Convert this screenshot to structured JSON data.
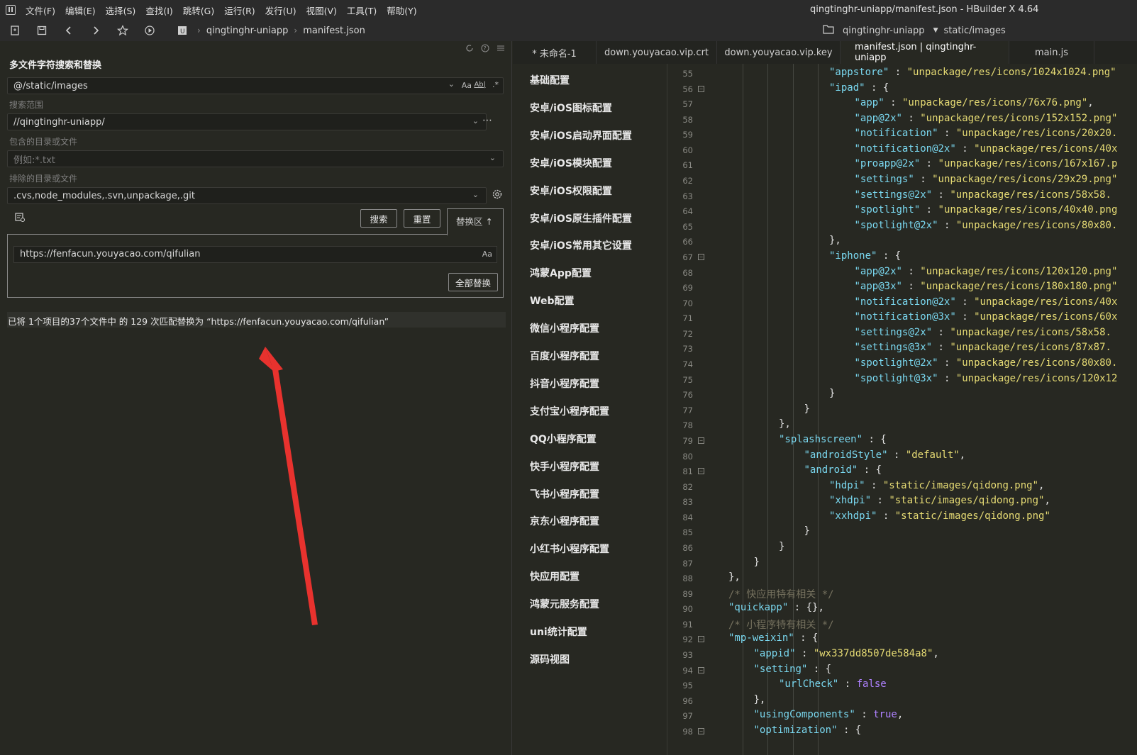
{
  "menubar": {
    "items": [
      "文件(F)",
      "编辑(E)",
      "选择(S)",
      "查找(I)",
      "跳转(G)",
      "运行(R)",
      "发行(U)",
      "视图(V)",
      "工具(T)",
      "帮助(Y)"
    ],
    "window_title": "qingtinghr-uniapp/manifest.json - HBuilder X 4.64"
  },
  "toolbar": {
    "crumb_project": "qingtinghr-uniapp",
    "crumb_file": "manifest.json",
    "right_project": "qingtinghr-uniapp",
    "right_path": "static/images"
  },
  "search_panel": {
    "title": "多文件字符搜索和替换",
    "search_value": "@/static/images",
    "option_case": "Aa",
    "option_word": "Ab|",
    "option_regex": ".*",
    "scope_label": "搜索范围",
    "scope_value": "//qingtinghr-uniapp/",
    "include_label": "包含的目录或文件",
    "include_placeholder": "例如:*.txt",
    "exclude_label": "排除的目录或文件",
    "exclude_value": ".cvs,node_modules,.svn,unpackage,.git",
    "search_button": "搜索",
    "reset_button": "重置",
    "replace_tab": "替换区 ↑",
    "replace_value": "https://fenfacun.youyacao.com/qifulian",
    "replace_case": "Aa",
    "replace_all_button": "全部替换",
    "status": "已将 1个项目的37个文件中 的 129 次匹配替换为 “https://fenfacun.youyacao.com/qifulian”"
  },
  "tabs": [
    {
      "label": "* 未命名-1",
      "active": false
    },
    {
      "label": "down.youyacao.vip.crt",
      "active": false
    },
    {
      "label": "down.youyacao.vip.key",
      "active": false
    },
    {
      "label": "manifest.json | qingtinghr-uniapp",
      "active": true
    },
    {
      "label": "main.js",
      "active": false
    }
  ],
  "manifest_nav": [
    "基础配置",
    "安卓/iOS图标配置",
    "安卓/iOS启动界面配置",
    "安卓/iOS模块配置",
    "安卓/iOS权限配置",
    "安卓/iOS原生插件配置",
    "安卓/iOS常用其它设置",
    "鸿蒙App配置",
    "Web配置",
    "微信小程序配置",
    "百度小程序配置",
    "抖音小程序配置",
    "支付宝小程序配置",
    "QQ小程序配置",
    "快手小程序配置",
    "飞书小程序配置",
    "京东小程序配置",
    "小红书小程序配置",
    "快应用配置",
    "鸿蒙元服务配置",
    "uni统计配置",
    "源码视图"
  ],
  "code_lines": [
    {
      "n": "55",
      "fold": false,
      "indent": 4,
      "parts": [
        [
          "k",
          "\"appstore\""
        ],
        [
          "p",
          " : "
        ],
        [
          "s",
          "\"unpackage/res/icons/1024x1024.png\""
        ]
      ]
    },
    {
      "n": "56",
      "fold": true,
      "indent": 4,
      "parts": [
        [
          "k",
          "\"ipad\""
        ],
        [
          "p",
          " : {"
        ]
      ]
    },
    {
      "n": "57",
      "fold": false,
      "indent": 5,
      "parts": [
        [
          "k",
          "\"app\""
        ],
        [
          "p",
          " : "
        ],
        [
          "s",
          "\"unpackage/res/icons/76x76.png\""
        ],
        [
          "p",
          ","
        ]
      ]
    },
    {
      "n": "58",
      "fold": false,
      "indent": 5,
      "parts": [
        [
          "k",
          "\"app@2x\""
        ],
        [
          "p",
          " : "
        ],
        [
          "s",
          "\"unpackage/res/icons/152x152.png\""
        ]
      ]
    },
    {
      "n": "59",
      "fold": false,
      "indent": 5,
      "parts": [
        [
          "k",
          "\"notification\""
        ],
        [
          "p",
          " : "
        ],
        [
          "s",
          "\"unpackage/res/icons/20x20."
        ]
      ]
    },
    {
      "n": "60",
      "fold": false,
      "indent": 5,
      "parts": [
        [
          "k",
          "\"notification@2x\""
        ],
        [
          "p",
          " : "
        ],
        [
          "s",
          "\"unpackage/res/icons/40x"
        ]
      ]
    },
    {
      "n": "61",
      "fold": false,
      "indent": 5,
      "parts": [
        [
          "k",
          "\"proapp@2x\""
        ],
        [
          "p",
          " : "
        ],
        [
          "s",
          "\"unpackage/res/icons/167x167.p"
        ]
      ]
    },
    {
      "n": "62",
      "fold": false,
      "indent": 5,
      "parts": [
        [
          "k",
          "\"settings\""
        ],
        [
          "p",
          " : "
        ],
        [
          "s",
          "\"unpackage/res/icons/29x29.png\""
        ]
      ]
    },
    {
      "n": "63",
      "fold": false,
      "indent": 5,
      "parts": [
        [
          "k",
          "\"settings@2x\""
        ],
        [
          "p",
          " : "
        ],
        [
          "s",
          "\"unpackage/res/icons/58x58."
        ]
      ]
    },
    {
      "n": "64",
      "fold": false,
      "indent": 5,
      "parts": [
        [
          "k",
          "\"spotlight\""
        ],
        [
          "p",
          " : "
        ],
        [
          "s",
          "\"unpackage/res/icons/40x40.png"
        ]
      ]
    },
    {
      "n": "65",
      "fold": false,
      "indent": 5,
      "parts": [
        [
          "k",
          "\"spotlight@2x\""
        ],
        [
          "p",
          " : "
        ],
        [
          "s",
          "\"unpackage/res/icons/80x80."
        ]
      ]
    },
    {
      "n": "66",
      "fold": false,
      "indent": 4,
      "parts": [
        [
          "p",
          "},"
        ]
      ]
    },
    {
      "n": "67",
      "fold": true,
      "indent": 4,
      "parts": [
        [
          "k",
          "\"iphone\""
        ],
        [
          "p",
          " : {"
        ]
      ]
    },
    {
      "n": "68",
      "fold": false,
      "indent": 5,
      "parts": [
        [
          "k",
          "\"app@2x\""
        ],
        [
          "p",
          " : "
        ],
        [
          "s",
          "\"unpackage/res/icons/120x120.png\""
        ]
      ]
    },
    {
      "n": "69",
      "fold": false,
      "indent": 5,
      "parts": [
        [
          "k",
          "\"app@3x\""
        ],
        [
          "p",
          " : "
        ],
        [
          "s",
          "\"unpackage/res/icons/180x180.png\""
        ]
      ]
    },
    {
      "n": "70",
      "fold": false,
      "indent": 5,
      "parts": [
        [
          "k",
          "\"notification@2x\""
        ],
        [
          "p",
          " : "
        ],
        [
          "s",
          "\"unpackage/res/icons/40x"
        ]
      ]
    },
    {
      "n": "71",
      "fold": false,
      "indent": 5,
      "parts": [
        [
          "k",
          "\"notification@3x\""
        ],
        [
          "p",
          " : "
        ],
        [
          "s",
          "\"unpackage/res/icons/60x"
        ]
      ]
    },
    {
      "n": "72",
      "fold": false,
      "indent": 5,
      "parts": [
        [
          "k",
          "\"settings@2x\""
        ],
        [
          "p",
          " : "
        ],
        [
          "s",
          "\"unpackage/res/icons/58x58."
        ]
      ]
    },
    {
      "n": "73",
      "fold": false,
      "indent": 5,
      "parts": [
        [
          "k",
          "\"settings@3x\""
        ],
        [
          "p",
          " : "
        ],
        [
          "s",
          "\"unpackage/res/icons/87x87."
        ]
      ]
    },
    {
      "n": "74",
      "fold": false,
      "indent": 5,
      "parts": [
        [
          "k",
          "\"spotlight@2x\""
        ],
        [
          "p",
          " : "
        ],
        [
          "s",
          "\"unpackage/res/icons/80x80."
        ]
      ]
    },
    {
      "n": "75",
      "fold": false,
      "indent": 5,
      "parts": [
        [
          "k",
          "\"spotlight@3x\""
        ],
        [
          "p",
          " : "
        ],
        [
          "s",
          "\"unpackage/res/icons/120x12"
        ]
      ]
    },
    {
      "n": "76",
      "fold": false,
      "indent": 4,
      "parts": [
        [
          "p",
          "}"
        ]
      ]
    },
    {
      "n": "77",
      "fold": false,
      "indent": 3,
      "parts": [
        [
          "p",
          "}"
        ]
      ]
    },
    {
      "n": "78",
      "fold": false,
      "indent": 2,
      "parts": [
        [
          "p",
          "},"
        ]
      ]
    },
    {
      "n": "79",
      "fold": true,
      "indent": 2,
      "parts": [
        [
          "k",
          "\"splashscreen\""
        ],
        [
          "p",
          " : {"
        ]
      ]
    },
    {
      "n": "80",
      "fold": false,
      "indent": 3,
      "parts": [
        [
          "k",
          "\"androidStyle\""
        ],
        [
          "p",
          " : "
        ],
        [
          "s",
          "\"default\""
        ],
        [
          "p",
          ","
        ]
      ]
    },
    {
      "n": "81",
      "fold": true,
      "indent": 3,
      "parts": [
        [
          "k",
          "\"android\""
        ],
        [
          "p",
          " : {"
        ]
      ]
    },
    {
      "n": "82",
      "fold": false,
      "indent": 4,
      "parts": [
        [
          "k",
          "\"hdpi\""
        ],
        [
          "p",
          " : "
        ],
        [
          "s",
          "\"static/images/qidong.png\""
        ],
        [
          "p",
          ","
        ]
      ]
    },
    {
      "n": "83",
      "fold": false,
      "indent": 4,
      "parts": [
        [
          "k",
          "\"xhdpi\""
        ],
        [
          "p",
          " : "
        ],
        [
          "s",
          "\"static/images/qidong.png\""
        ],
        [
          "p",
          ","
        ]
      ]
    },
    {
      "n": "84",
      "fold": false,
      "indent": 4,
      "parts": [
        [
          "k",
          "\"xxhdpi\""
        ],
        [
          "p",
          " : "
        ],
        [
          "s",
          "\"static/images/qidong.png\""
        ]
      ]
    },
    {
      "n": "85",
      "fold": false,
      "indent": 3,
      "parts": [
        [
          "p",
          "}"
        ]
      ]
    },
    {
      "n": "86",
      "fold": false,
      "indent": 2,
      "parts": [
        [
          "p",
          "}"
        ]
      ]
    },
    {
      "n": "87",
      "fold": false,
      "indent": 1,
      "parts": [
        [
          "p",
          "}"
        ]
      ]
    },
    {
      "n": "88",
      "fold": false,
      "indent": 0,
      "parts": [
        [
          "p",
          "},"
        ]
      ]
    },
    {
      "n": "89",
      "fold": false,
      "indent": 0,
      "parts": [
        [
          "c",
          "/* 快应用特有相关 */"
        ]
      ]
    },
    {
      "n": "90",
      "fold": false,
      "indent": 0,
      "parts": [
        [
          "k",
          "\"quickapp\""
        ],
        [
          "p",
          " : {},"
        ]
      ]
    },
    {
      "n": "91",
      "fold": false,
      "indent": 0,
      "parts": [
        [
          "c",
          "/* 小程序特有相关 */"
        ]
      ]
    },
    {
      "n": "92",
      "fold": true,
      "indent": 0,
      "parts": [
        [
          "k",
          "\"mp-weixin\""
        ],
        [
          "p",
          " : {"
        ]
      ]
    },
    {
      "n": "93",
      "fold": false,
      "indent": 1,
      "parts": [
        [
          "k",
          "\"appid\""
        ],
        [
          "p",
          " : "
        ],
        [
          "s",
          "\"wx337dd8507de584a8\""
        ],
        [
          "p",
          ","
        ]
      ]
    },
    {
      "n": "94",
      "fold": true,
      "indent": 1,
      "parts": [
        [
          "k",
          "\"setting\""
        ],
        [
          "p",
          " : {"
        ]
      ]
    },
    {
      "n": "95",
      "fold": false,
      "indent": 2,
      "parts": [
        [
          "k",
          "\"urlCheck\""
        ],
        [
          "p",
          " : "
        ],
        [
          "b",
          "false"
        ]
      ]
    },
    {
      "n": "96",
      "fold": false,
      "indent": 1,
      "parts": [
        [
          "p",
          "},"
        ]
      ]
    },
    {
      "n": "97",
      "fold": false,
      "indent": 1,
      "parts": [
        [
          "k",
          "\"usingComponents\""
        ],
        [
          "p",
          " : "
        ],
        [
          "b",
          "true"
        ],
        [
          "p",
          ","
        ]
      ]
    },
    {
      "n": "98",
      "fold": true,
      "indent": 1,
      "parts": [
        [
          "k",
          "\"optimization\""
        ],
        [
          "p",
          " : {"
        ]
      ]
    }
  ]
}
